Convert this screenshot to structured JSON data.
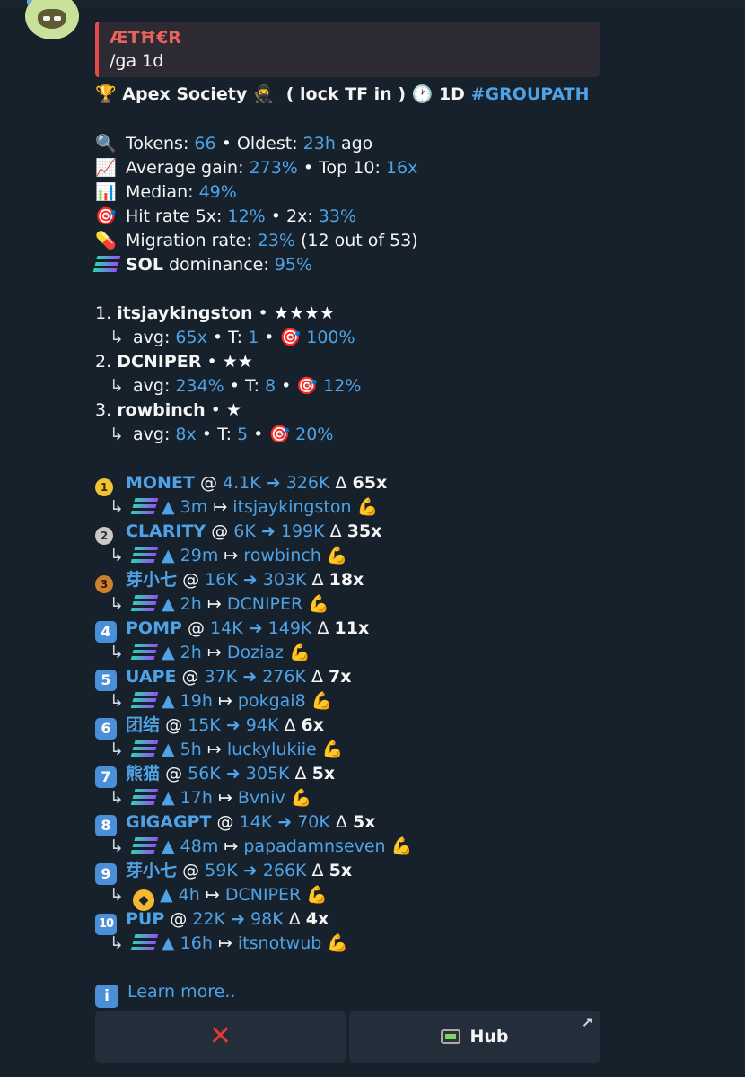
{
  "header": {
    "reply_name": "ÆTĦ€R",
    "reply_text": "/ga 1d"
  },
  "title": {
    "prefix_icon": "🏆",
    "name": "Apex Society 🥷",
    "lock": "( lock TF in )",
    "clock_icon": "🕐",
    "tf": "1D",
    "tag": "#GROUPATH"
  },
  "stats": {
    "tokens_label": "Tokens:",
    "tokens_value": "66",
    "oldest_label": "• Oldest:",
    "oldest_value": "23h",
    "oldest_suffix": "ago",
    "avg_label": "Average gain:",
    "avg_value": "273%",
    "top10_label": "• Top 10:",
    "top10_value": "16x",
    "median_label": "Median:",
    "median_value": "49%",
    "hit_label": "Hit rate 5x:",
    "hit5_value": "12%",
    "hit2_label": "• 2x:",
    "hit2_value": "33%",
    "mig_label": "Migration rate:",
    "mig_value": "23%",
    "mig_suffix": "(12 out of 53)",
    "sol_label": "SOL",
    "dom_label": "dominance:",
    "dom_value": "95%"
  },
  "callers": [
    {
      "rank": "1.",
      "name": "itsjaykingston",
      "stars": "★★★★",
      "avg": "65x",
      "t": "1",
      "hit": "100%"
    },
    {
      "rank": "2.",
      "name": "DCNIPER",
      "stars": "★★",
      "avg": "234%",
      "t": "8",
      "hit": "12%"
    },
    {
      "rank": "3.",
      "name": "rowbinch",
      "stars": "★",
      "avg": "8x",
      "t": "5",
      "hit": "20%"
    }
  ],
  "caller_labels": {
    "avg": "avg:",
    "t": "T:",
    "sep": "•",
    "arrow": "↳",
    "target_icon": "🎯"
  },
  "tokens": [
    {
      "badge": "1",
      "name": "MONET",
      "from": "4.1K",
      "to": "326K",
      "mult": "65x",
      "chain": "sol",
      "age": "3m",
      "caller": "itsjaykingston"
    },
    {
      "badge": "2",
      "name": "CLARITY",
      "from": "6K",
      "to": "199K",
      "mult": "35x",
      "chain": "sol",
      "age": "29m",
      "caller": "rowbinch"
    },
    {
      "badge": "3",
      "name": "芽小七",
      "from": "16K",
      "to": "303K",
      "mult": "18x",
      "chain": "sol",
      "age": "2h",
      "caller": "DCNIPER"
    },
    {
      "badge": "4",
      "name": "POMP",
      "from": "14K",
      "to": "149K",
      "mult": "11x",
      "chain": "sol",
      "age": "2h",
      "caller": "Doziaz"
    },
    {
      "badge": "5",
      "name": "UAPE",
      "from": "37K",
      "to": "276K",
      "mult": "7x",
      "chain": "sol",
      "age": "19h",
      "caller": "pokgai8"
    },
    {
      "badge": "6",
      "name": "团结",
      "from": "15K",
      "to": "94K",
      "mult": "6x",
      "chain": "sol",
      "age": "5h",
      "caller": "luckylukiie"
    },
    {
      "badge": "7",
      "name": "熊猫",
      "from": "56K",
      "to": "305K",
      "mult": "5x",
      "chain": "sol",
      "age": "17h",
      "caller": "Bvniv"
    },
    {
      "badge": "8",
      "name": "GIGAGPT",
      "from": "14K",
      "to": "70K",
      "mult": "5x",
      "chain": "sol",
      "age": "48m",
      "caller": "papadamnseven"
    },
    {
      "badge": "9",
      "name": "芽小七",
      "from": "59K",
      "to": "266K",
      "mult": "5x",
      "chain": "bnb",
      "age": "4h",
      "caller": "DCNIPER"
    },
    {
      "badge": "10",
      "name": "PUP",
      "from": "22K",
      "to": "98K",
      "mult": "4x",
      "chain": "sol",
      "age": "16h",
      "caller": "itsnotwub"
    }
  ],
  "token_labels": {
    "at": "@",
    "to_arrow": "➜",
    "delta": "Δ",
    "up": "▲",
    "mapsto": "↦",
    "flex": "💪",
    "arrow": "↳"
  },
  "footer": {
    "info_icon": "i",
    "learn_more": "Learn more..",
    "close_label": "✕",
    "hub_label": "Hub",
    "ext_icon": "↗"
  },
  "colors": {
    "accent": "#4fa2e5",
    "background": "#17212b",
    "reply_bar": "#e84a4a",
    "button": "#232e3a"
  }
}
